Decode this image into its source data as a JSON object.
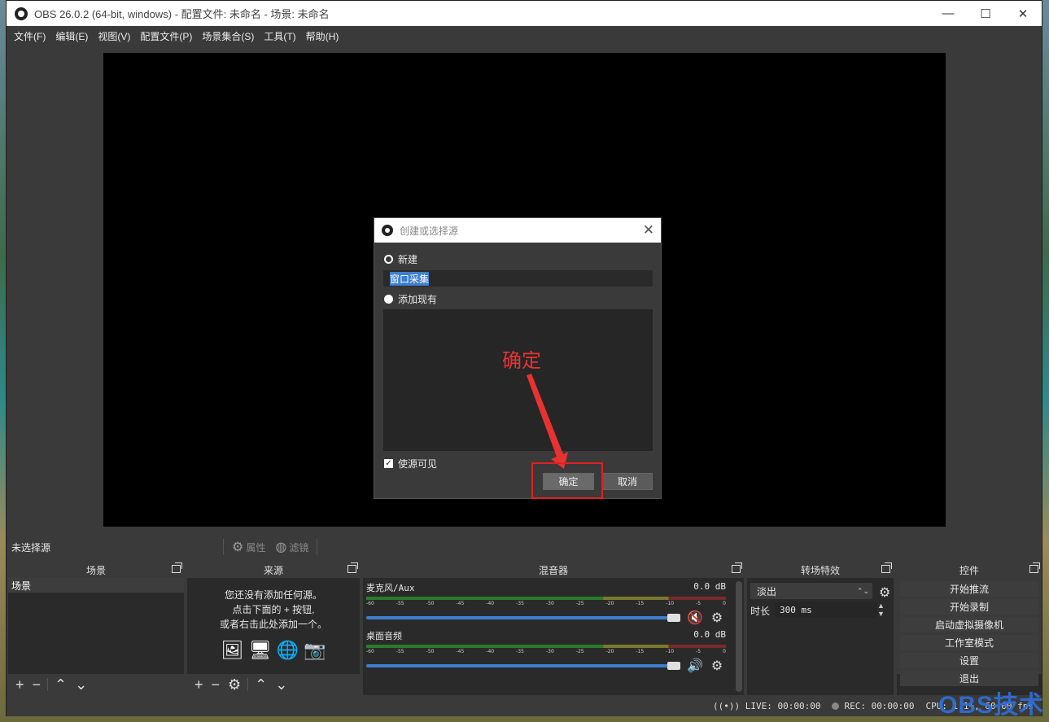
{
  "window": {
    "title": "OBS 26.0.2 (64-bit, windows) - 配置文件: 未命名 - 场景: 未命名",
    "minimize": "—",
    "maximize": "☐",
    "close": "✕"
  },
  "menu": [
    "文件(F)",
    "编辑(E)",
    "视图(V)",
    "配置文件(P)",
    "场景集合(S)",
    "工具(T)",
    "帮助(H)"
  ],
  "dialog": {
    "title": "创建或选择源",
    "close": "✕",
    "new_label": "新建",
    "new_name": "窗口采集",
    "existing_label": "添加现有",
    "visible_label": "使源可见",
    "ok": "确定",
    "cancel": "取消",
    "annotation": "确定",
    "annotation_color": "#e83232"
  },
  "context": {
    "no_source": "未选择源",
    "properties": "属性",
    "filters": "滤镜"
  },
  "docks": {
    "scenes": {
      "title": "场景",
      "items": [
        "场景"
      ]
    },
    "sources": {
      "title": "来源",
      "empty_line1": "您还没有添加任何源。",
      "empty_line2": "点击下面的 + 按钮,",
      "empty_line3": "或者右击此处添加一个。"
    },
    "mixer": {
      "title": "混音器",
      "channels": [
        {
          "name": "麦克风/Aux",
          "db": "0.0 dB",
          "muted": true
        },
        {
          "name": "桌面音频",
          "db": "0.0 dB",
          "muted": false
        }
      ],
      "ticks": [
        "-60",
        "-55",
        "-50",
        "-45",
        "-40",
        "-35",
        "-30",
        "-25",
        "-20",
        "-15",
        "-10",
        "-5",
        "0"
      ]
    },
    "transitions": {
      "title": "转场特效",
      "selected": "淡出",
      "duration_label": "时长",
      "duration": "300 ms"
    },
    "controls": {
      "title": "控件",
      "buttons": [
        "开始推流",
        "开始录制",
        "启动虚拟摄像机",
        "工作室模式",
        "设置",
        "退出"
      ]
    }
  },
  "status": {
    "live": "LIVE: 00:00:00",
    "rec": "REC: 00:00:00",
    "cpu": "CPU: 1.1%, 60.00 fps"
  },
  "watermark": "OBS技术",
  "colors": {
    "accent": "#3d7fce",
    "highlight": "#e02020",
    "mute": "#d02020"
  }
}
